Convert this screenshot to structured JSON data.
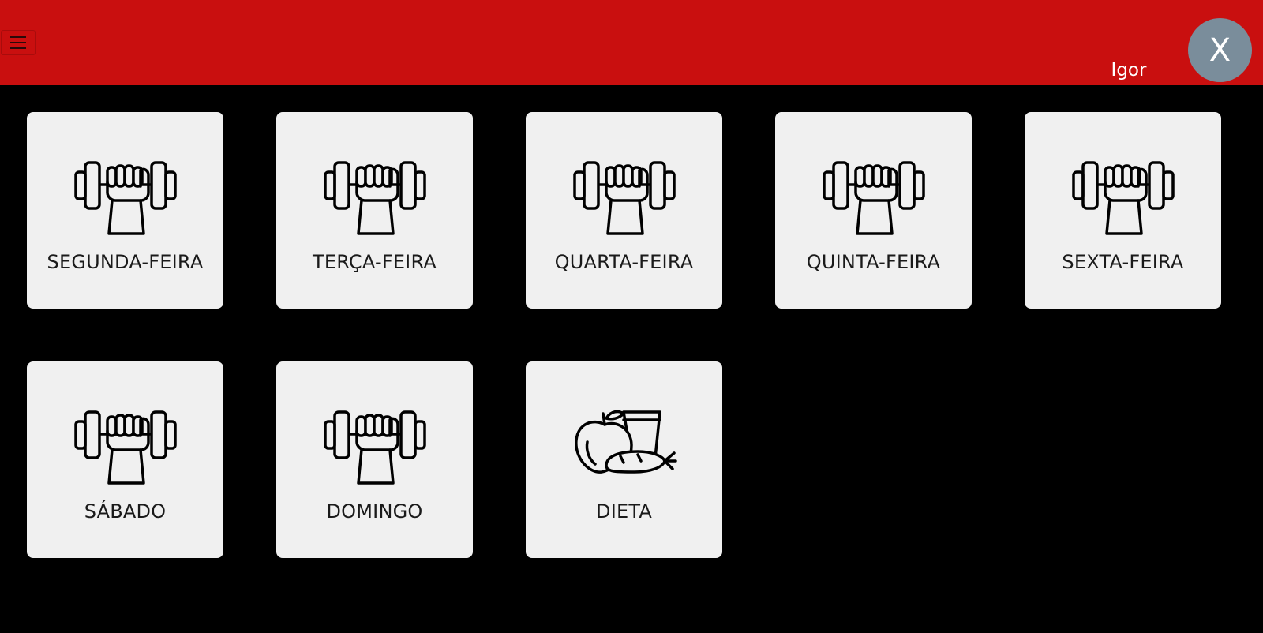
{
  "header": {
    "user_name": "Igor",
    "avatar_letter": "X",
    "background_color": "#c90f0f",
    "avatar_color": "#7a8d9b"
  },
  "cards": [
    {
      "label": "SEGUNDA-FEIRA",
      "icon": "dumbbell-icon"
    },
    {
      "label": "TERÇA-FEIRA",
      "icon": "dumbbell-icon"
    },
    {
      "label": "QUARTA-FEIRA",
      "icon": "dumbbell-icon"
    },
    {
      "label": "QUINTA-FEIRA",
      "icon": "dumbbell-icon"
    },
    {
      "label": "SEXTA-FEIRA",
      "icon": "dumbbell-icon"
    },
    {
      "label": "SÁBADO",
      "icon": "dumbbell-icon"
    },
    {
      "label": "DOMINGO",
      "icon": "dumbbell-icon"
    },
    {
      "label": "DIETA",
      "icon": "diet-icon"
    }
  ]
}
